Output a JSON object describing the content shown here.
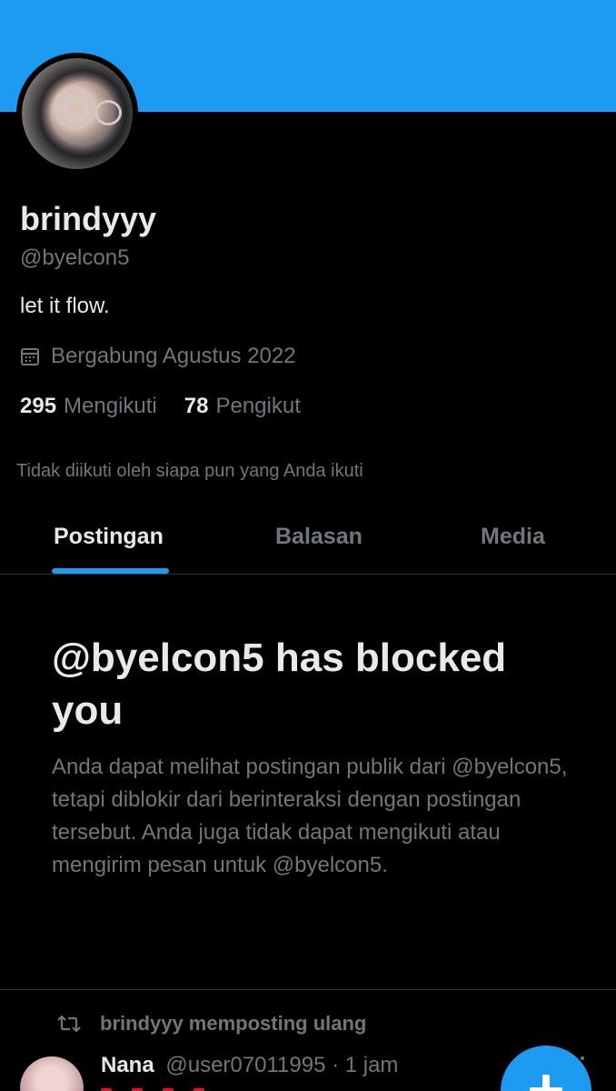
{
  "profile": {
    "display_name": "brindyyy",
    "handle": "@byelcon5",
    "bio": "let it flow.",
    "joined": "Bergabung Agustus 2022",
    "following_count": "295",
    "following_label": "Mengikuti",
    "followers_count": "78",
    "followers_label": "Pengikut",
    "followers_note": "Tidak diikuti oleh siapa pun yang Anda ikuti"
  },
  "tabs": [
    {
      "label": "Postingan",
      "active": true
    },
    {
      "label": "Balasan",
      "active": false
    },
    {
      "label": "Media",
      "active": false
    }
  ],
  "blocked": {
    "title": "@byelcon5 has blocked you",
    "body": "Anda dapat melihat postingan publik dari @byelcon5, tetapi diblokir dari berinteraksi dengan postingan tersebut. Anda juga tidak dapat mengikuti atau mengirim pesan untuk @byelcon5."
  },
  "post": {
    "repost_label": "brindyyy memposting ulang",
    "author_name": "Nana",
    "author_meta": "@user07011995 · 1 jam"
  },
  "icons": {
    "calendar": "calendar-icon",
    "repost": "repost-icon",
    "compose": "plus-icon"
  },
  "colors": {
    "accent": "#1d9bf0",
    "background": "#000000",
    "text": "#e7e9ea",
    "muted": "#71767b"
  }
}
